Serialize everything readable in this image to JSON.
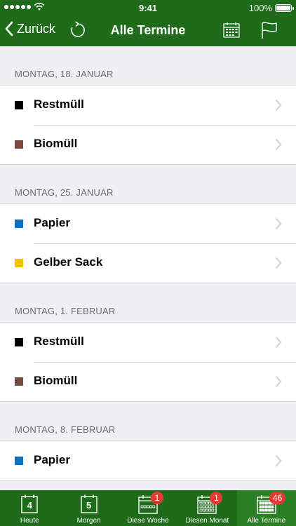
{
  "status_bar": {
    "time": "9:41",
    "battery": "100%"
  },
  "nav": {
    "back_label": "Zurück",
    "title": "Alle Termine"
  },
  "colors": {
    "Restmüll": "#000000",
    "Biomüll": "#7b4a3e",
    "Papier": "#0a72c1",
    "Gelber Sack": "#f2c400"
  },
  "sections": [
    {
      "header": "MONTAG, 18. JANUAR",
      "items": [
        {
          "label": "Restmüll",
          "color": "#000000"
        },
        {
          "label": "Biomüll",
          "color": "#7b4a3e"
        }
      ]
    },
    {
      "header": "MONTAG, 25. JANUAR",
      "items": [
        {
          "label": "Papier",
          "color": "#0a72c1"
        },
        {
          "label": "Gelber Sack",
          "color": "#f2c400"
        }
      ]
    },
    {
      "header": "MONTAG, 1. FEBRUAR",
      "items": [
        {
          "label": "Restmüll",
          "color": "#000000"
        },
        {
          "label": "Biomüll",
          "color": "#7b4a3e"
        }
      ]
    },
    {
      "header": "MONTAG, 8. FEBRUAR",
      "items": [
        {
          "label": "Papier",
          "color": "#0a72c1"
        }
      ]
    }
  ],
  "tabbar": {
    "tabs": [
      {
        "label": "Heute",
        "icon": "calendar-day-icon",
        "day": "4",
        "badge": ""
      },
      {
        "label": "Morgen",
        "icon": "calendar-day-icon",
        "day": "5",
        "badge": ""
      },
      {
        "label": "Diese Woche",
        "icon": "calendar-week-icon",
        "day": "",
        "badge": "1"
      },
      {
        "label": "Diesen Monat",
        "icon": "calendar-month-icon",
        "day": "",
        "badge": "1"
      },
      {
        "label": "Alle Termine",
        "icon": "calendar-all-icon",
        "day": "",
        "badge": "46"
      }
    ]
  }
}
